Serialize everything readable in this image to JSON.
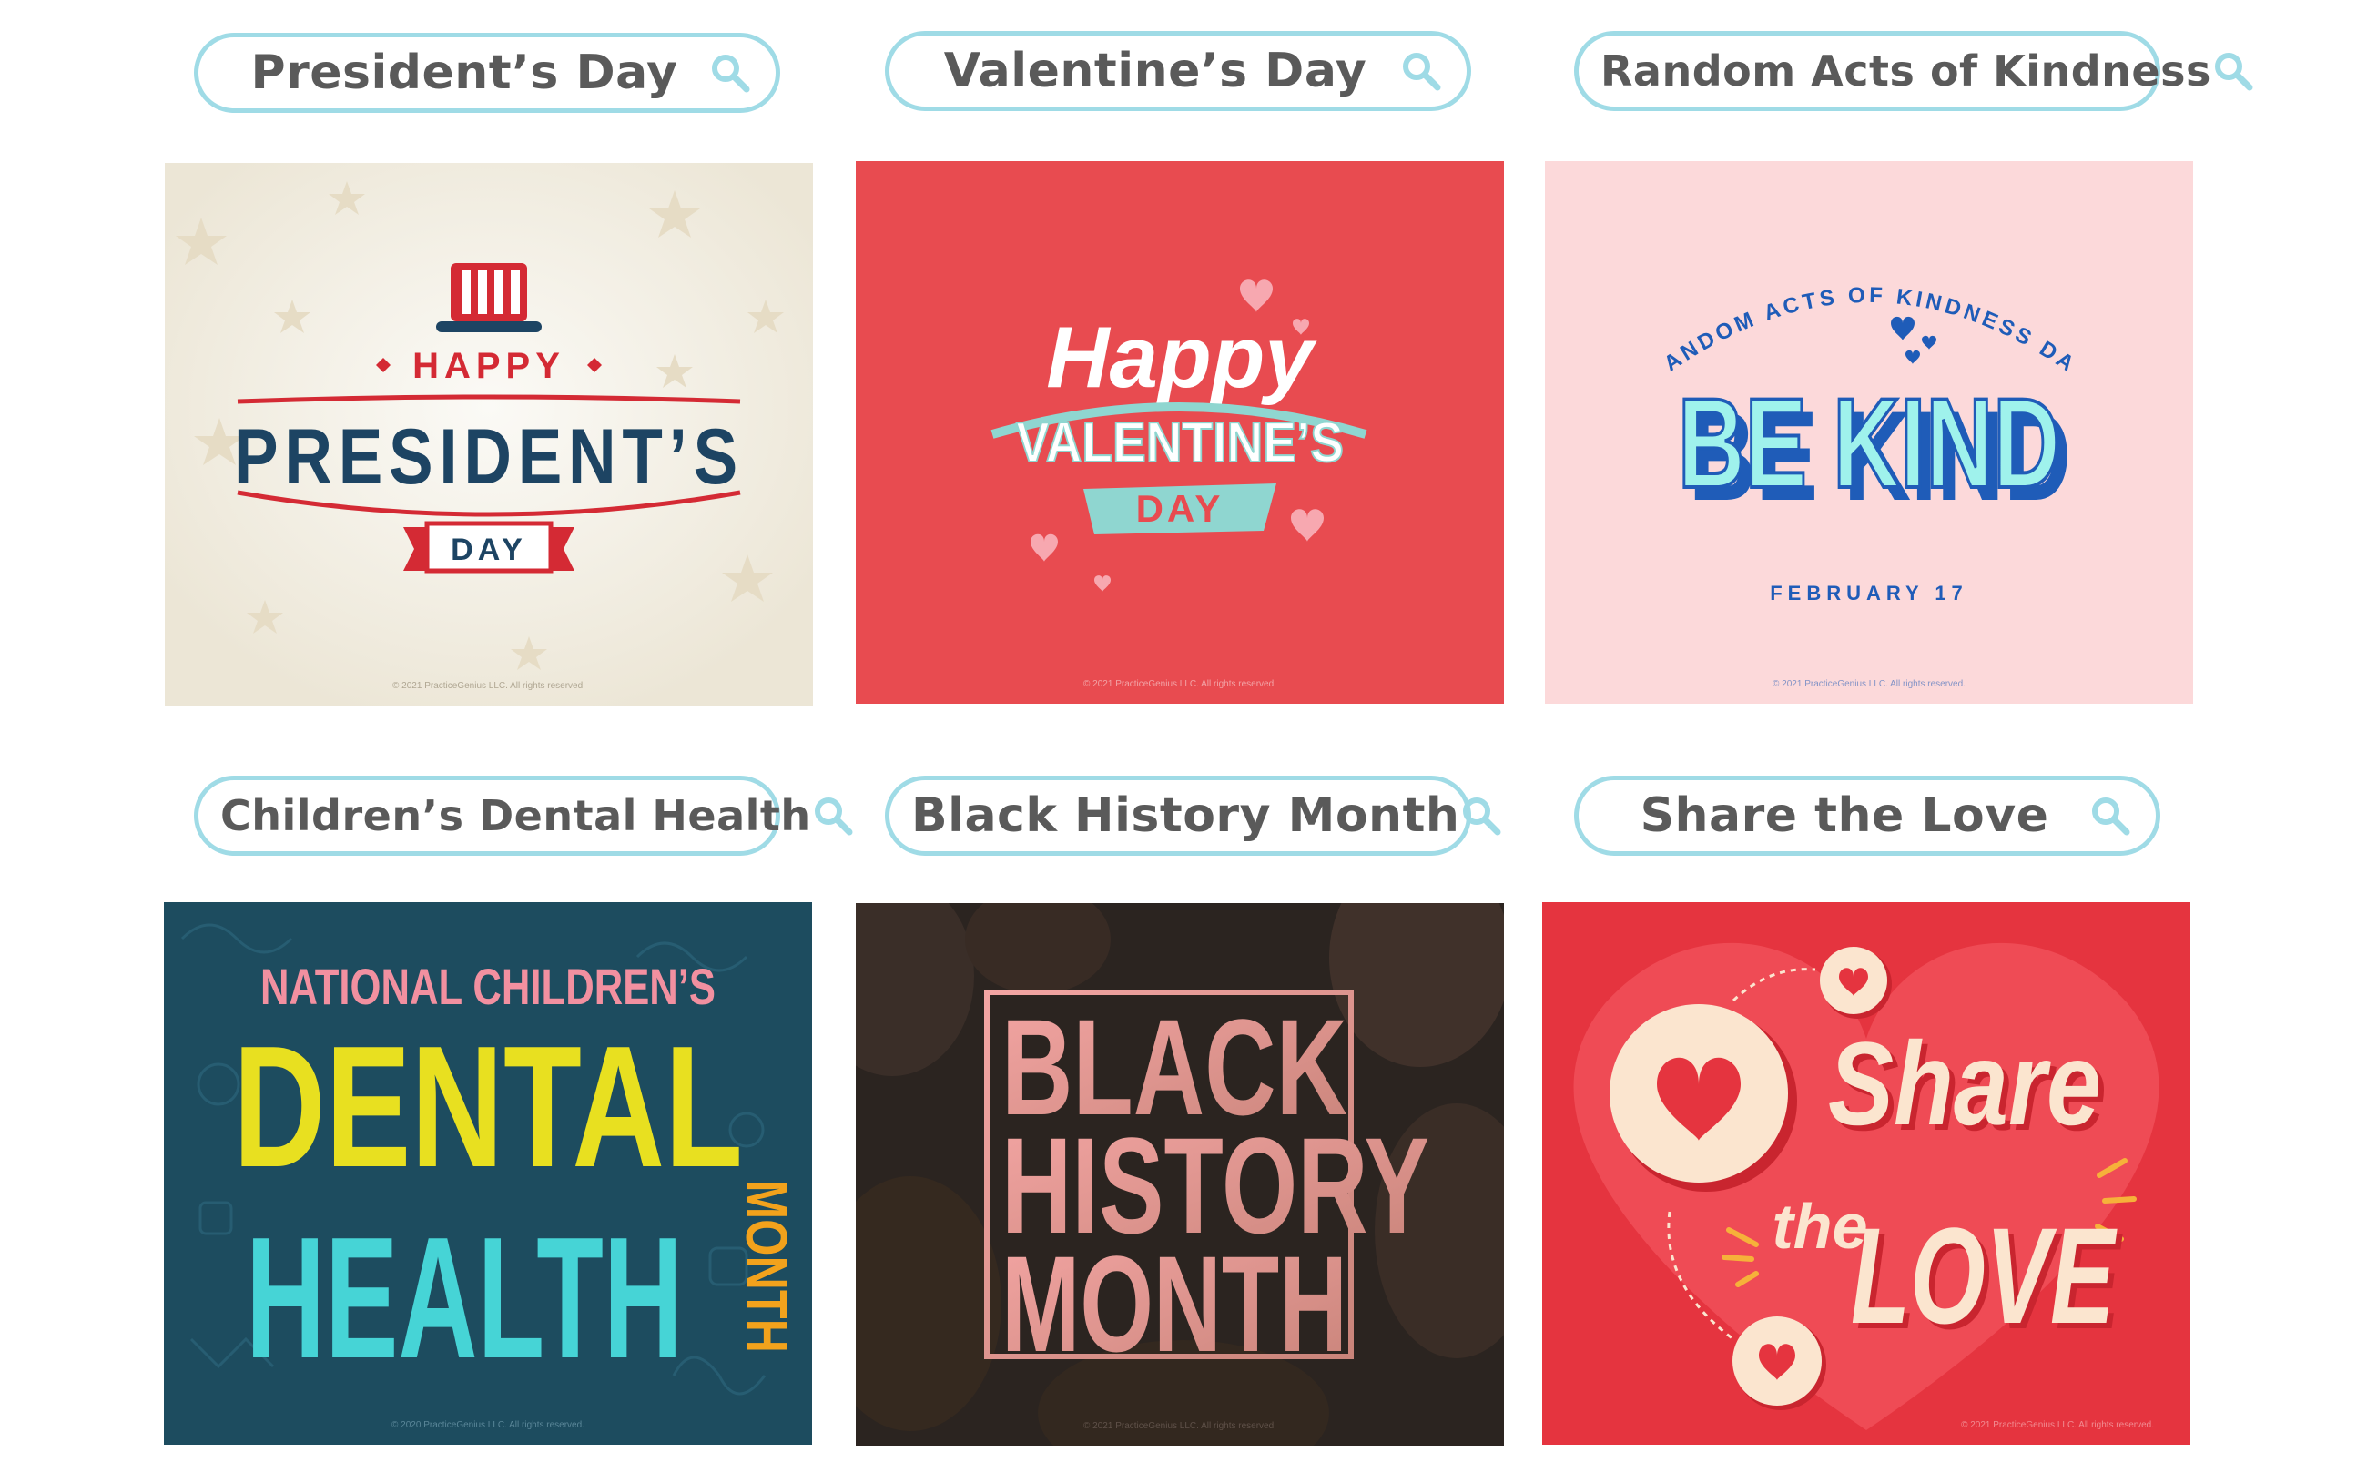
{
  "tiles": [
    {
      "search_label": "President’s Day",
      "card": {
        "line1": "HAPPY",
        "line2": "PRESIDENT’S",
        "line3": "DAY",
        "copyright": "© 2021 PracticeGenius LLC. All rights reserved."
      }
    },
    {
      "search_label": "Valentine’s Day",
      "card": {
        "line1": "Happy",
        "line2": "VALENTINE’S",
        "line3": "DAY",
        "copyright": "© 2021 PracticeGenius LLC. All rights reserved."
      }
    },
    {
      "search_label": "Random Acts of Kindness",
      "card": {
        "arc": "RANDOM ACTS OF KINDNESS DAY",
        "main": "BE KIND",
        "date": "FEBRUARY 17",
        "copyright": "© 2021 PracticeGenius LLC. All rights reserved."
      }
    },
    {
      "search_label": "Children’s Dental Health",
      "card": {
        "line1": "NATIONAL CHILDREN’S",
        "line2": "DENTAL",
        "line3": "HEALTH",
        "line4": "MONTH",
        "copyright": "© 2020 PracticeGenius LLC. All rights reserved."
      }
    },
    {
      "search_label": "Black History Month",
      "card": {
        "line1": "BLACK",
        "line2": "HISTORY",
        "line3": "MONTH",
        "copyright": "© 2021 PracticeGenius LLC. All rights reserved."
      }
    },
    {
      "search_label": "Share the Love",
      "card": {
        "line1": "Share",
        "line2": "the",
        "line3": "LOVE",
        "copyright": "© 2021 PracticeGenius LLC. All rights reserved."
      }
    }
  ],
  "colors": {
    "search_border": "#9fdbe6",
    "presidents_bg": "#f2efe6",
    "valentines_bg": "#e84b50",
    "kindness_bg": "#fcd9da",
    "dental_bg": "#1d4c5f",
    "black_history_bg": "#2b2420",
    "share_bg": "#e5343f"
  }
}
